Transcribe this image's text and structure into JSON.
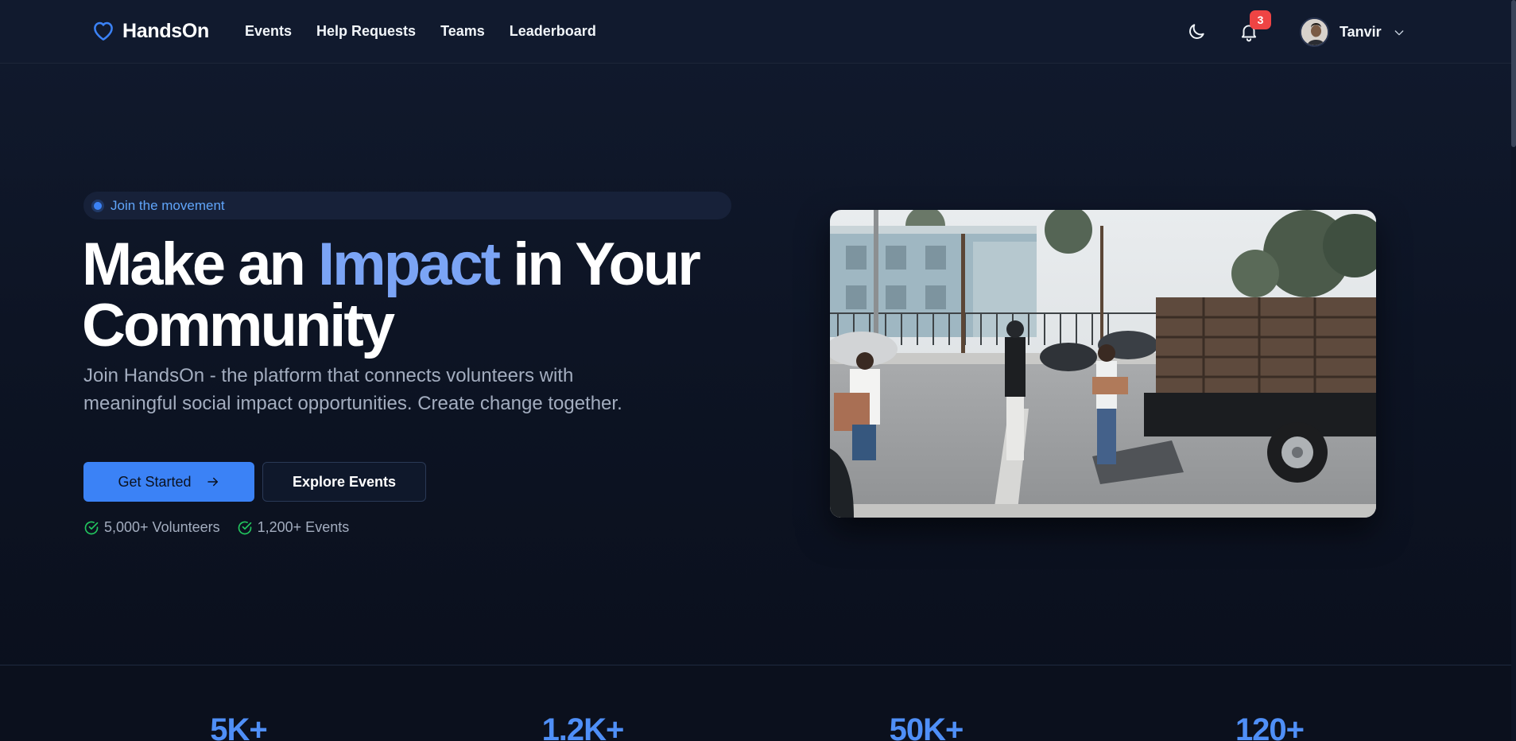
{
  "brand": {
    "name": "HandsOn",
    "accent": "#3b82f6"
  },
  "nav": {
    "links": [
      "Events",
      "Help Requests",
      "Teams",
      "Leaderboard"
    ],
    "notifications_count": "3",
    "user_name": "Tanvir"
  },
  "hero": {
    "pill": "Join the movement",
    "headline_part1": "Make an ",
    "headline_accent": "Impact",
    "headline_part2": " in Your Community",
    "subtext": "Join HandsOn - the platform that connects volunteers with meaningful social impact opportunities. Create change together.",
    "primary_button": "Get Started",
    "secondary_button": "Explore Events",
    "checks": [
      "5,000+ Volunteers",
      "1,200+ Events"
    ]
  },
  "stats": [
    "5K+",
    "1.2K+",
    "50K+",
    "120+"
  ],
  "icons": {
    "logo": "heart-icon",
    "theme": "moon-icon",
    "notifications": "bell-icon",
    "user_menu": "chevron-down-icon",
    "primary_button": "arrow-right-icon",
    "checks": "check-circle-icon"
  },
  "colors": {
    "check": "#22c55e",
    "badge": "#ef4444",
    "headline_accent": "#7ba4f5"
  }
}
